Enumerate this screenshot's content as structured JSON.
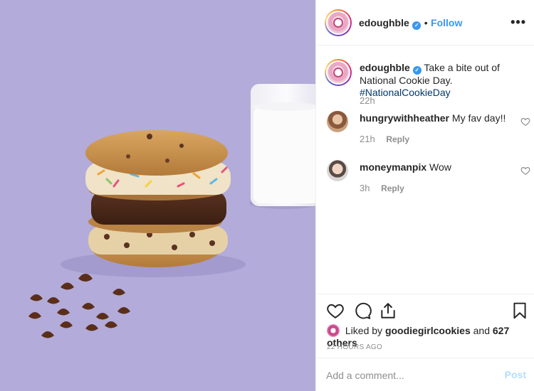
{
  "post": {
    "author": "edoughble",
    "verified": true,
    "separator": "•",
    "follow_label": "Follow",
    "more_label": "•••",
    "caption": {
      "author": "edoughble",
      "text": "Take a bite out of National Cookie Day.",
      "hashtag": "#NationalCookieDay",
      "time": "22h"
    },
    "comments": [
      {
        "user": "hungrywithheather",
        "text": "My fav day!!",
        "time": "21h",
        "reply_label": "Reply"
      },
      {
        "user": "moneymanpix",
        "text": "Wow",
        "time": "3h",
        "reply_label": "Reply"
      }
    ],
    "likes": {
      "prefix": "Liked by",
      "user": "goodiegirlcookies",
      "joiner": "and",
      "others": "627 others"
    },
    "timestamp": "22 HOURS AGO",
    "add_comment_placeholder": "Add a comment...",
    "post_label": "Post"
  },
  "icons": {
    "like": "heart-icon",
    "comment": "comment-icon",
    "share": "share-icon",
    "save": "bookmark-icon",
    "verified": "verified-badge-icon",
    "more": "more-options-icon"
  },
  "colors": {
    "accent": "#3897f0",
    "hashtag": "#00376b",
    "muted": "#8e8e8e",
    "post_disabled": "#b2dffc",
    "photo_background": "#b3abd9"
  }
}
